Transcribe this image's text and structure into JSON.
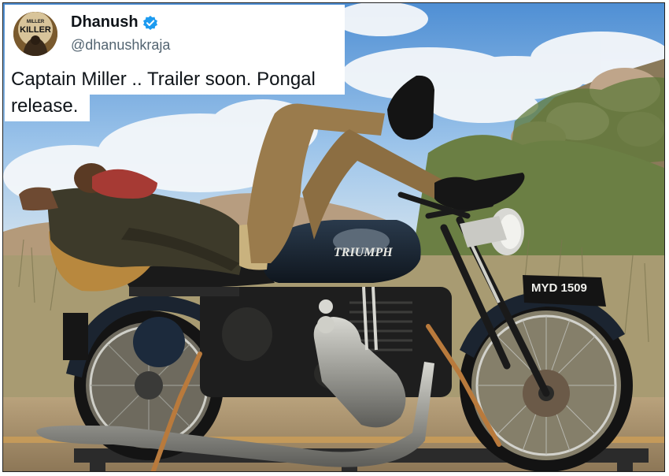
{
  "tweet": {
    "display_name": "Dhanush",
    "handle": "@dhanushkraja",
    "text": "Captain Miller .. Trailer soon. Pongal release.",
    "verified": true,
    "verified_color": "#1d9bf0"
  },
  "avatar": {
    "text_top": "MILLER",
    "text_main": "KILLER"
  },
  "photo": {
    "tank_brand": "TRIUMPH",
    "license_plate": "MYD 1509"
  }
}
